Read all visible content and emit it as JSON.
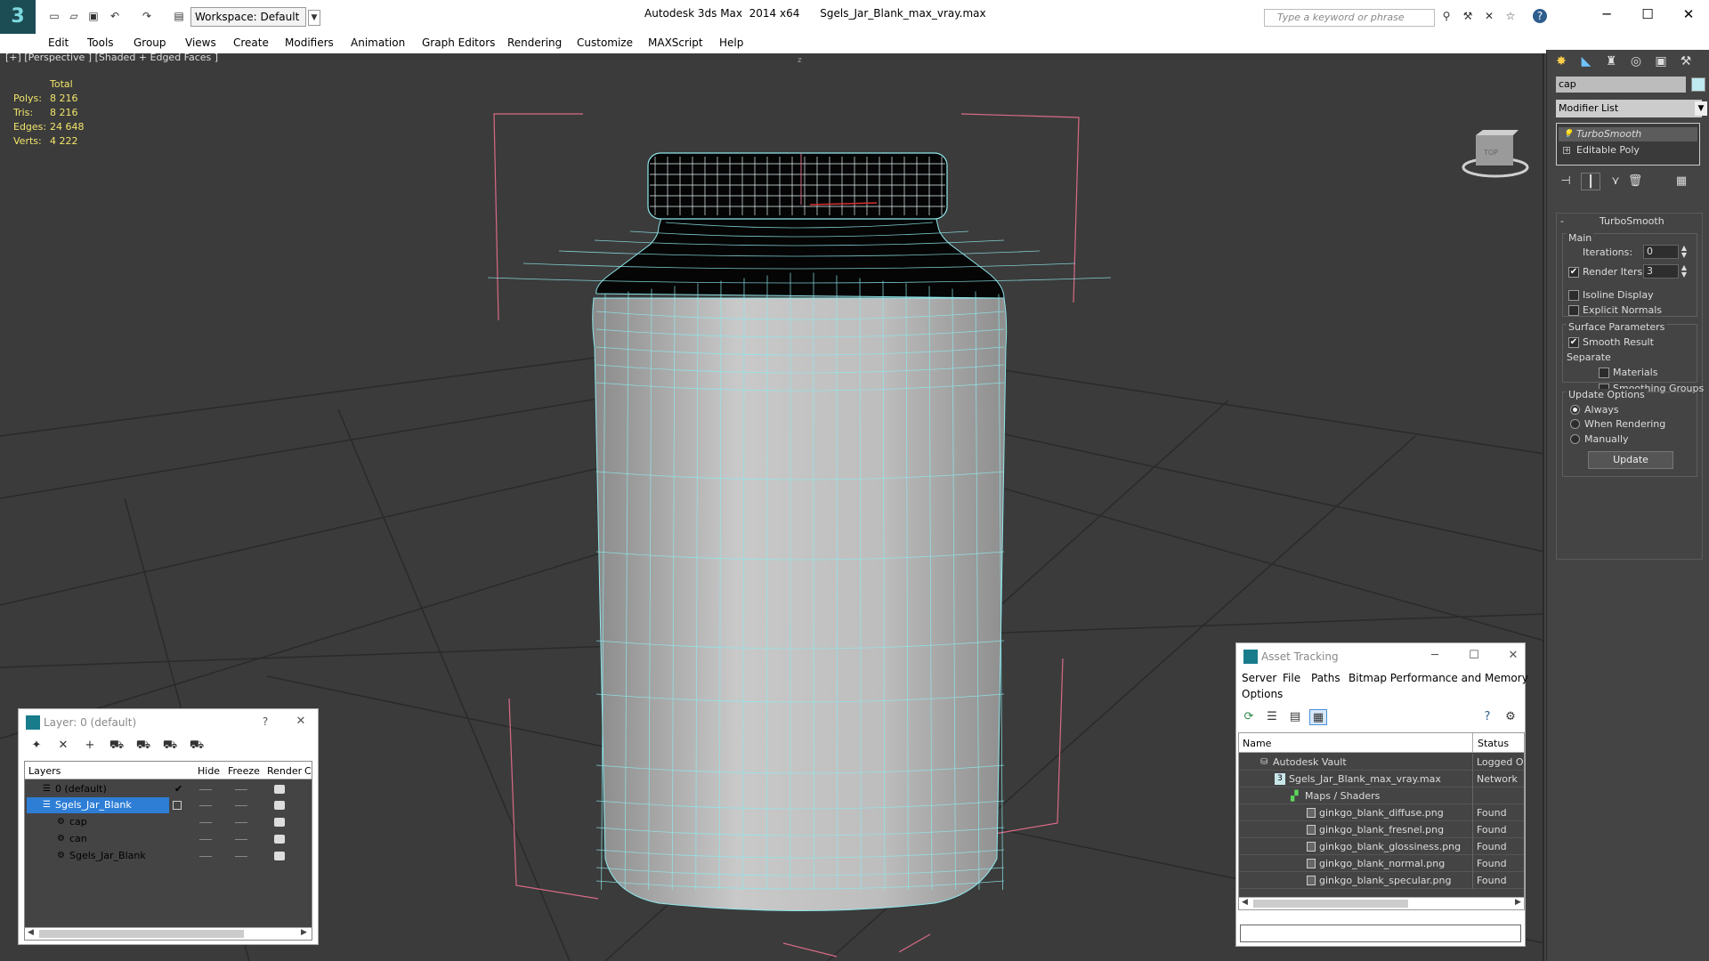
{
  "app": {
    "title_app": "Autodesk 3ds Max  2014 x64",
    "title_file": "Sgels_Jar_Blank_max_vray.max",
    "workspace": "Workspace: Default",
    "search_placeholder": "Type a keyword or phrase"
  },
  "menu": [
    "Edit",
    "Tools",
    "Group",
    "Views",
    "Create",
    "Modifiers",
    "Animation",
    "Graph Editors",
    "Rendering",
    "Customize",
    "MAXScript",
    "Help"
  ],
  "viewport": {
    "label": "[+] [Perspective ] [Shaded + Edged Faces ]",
    "stats_header": "Total",
    "stats": [
      {
        "label": "Polys:",
        "value": "8 216"
      },
      {
        "label": "Tris:",
        "value": "8 216"
      },
      {
        "label": "Edges:",
        "value": "24 648"
      },
      {
        "label": "Verts:",
        "value": "4 222"
      }
    ],
    "axis_label": "z",
    "viewcube_label": "TOP"
  },
  "command_panel": {
    "object_name": "cap",
    "object_color": "#bfeaf0",
    "modifier_list": "Modifier List",
    "stack": [
      "TurboSmooth",
      "Editable Poly"
    ],
    "turbosmooth": {
      "title": "TurboSmooth",
      "main_group": "Main",
      "iterations_label": "Iterations:",
      "iterations_value": "0",
      "render_iters_label": "Render Iters:",
      "render_iters_value": "3",
      "render_iters_checked": true,
      "isoline_label": "Isoline Display",
      "explicit_normals_label": "Explicit Normals",
      "surface_group": "Surface Parameters",
      "smooth_result_label": "Smooth Result",
      "separate_label": "Separate",
      "materials_label": "Materials",
      "smoothing_groups_label": "Smoothing Groups",
      "update_group": "Update Options",
      "update_always": "Always",
      "update_when_rendering": "When Rendering",
      "update_manually": "Manually",
      "update_button": "Update"
    }
  },
  "layer_panel": {
    "title": "Layer: 0 (default)",
    "help": "?",
    "columns": [
      "Layers",
      "Hide",
      "Freeze",
      "Render",
      "C"
    ],
    "rows": [
      "0 (default)",
      "Sgels_Jar_Blank",
      "cap",
      "can",
      "Sgels_Jar_Blank"
    ]
  },
  "asset_tracking": {
    "title": "Asset Tracking",
    "menu": [
      "Server",
      "File",
      "Paths",
      "Bitmap Performance and Memory",
      "Options"
    ],
    "columns": [
      "Name",
      "Status"
    ],
    "rows": [
      {
        "name": "Autodesk Vault",
        "status": "Logged O"
      },
      {
        "name": "Sgels_Jar_Blank_max_vray.max",
        "status": "Network"
      },
      {
        "name": "Maps / Shaders",
        "status": ""
      },
      {
        "name": "ginkgo_blank_diffuse.png",
        "status": "Found"
      },
      {
        "name": "ginkgo_blank_fresnel.png",
        "status": "Found"
      },
      {
        "name": "ginkgo_blank_glossiness.png",
        "status": "Found"
      },
      {
        "name": "ginkgo_blank_normal.png",
        "status": "Found"
      },
      {
        "name": "ginkgo_blank_specular.png",
        "status": "Found"
      }
    ]
  }
}
